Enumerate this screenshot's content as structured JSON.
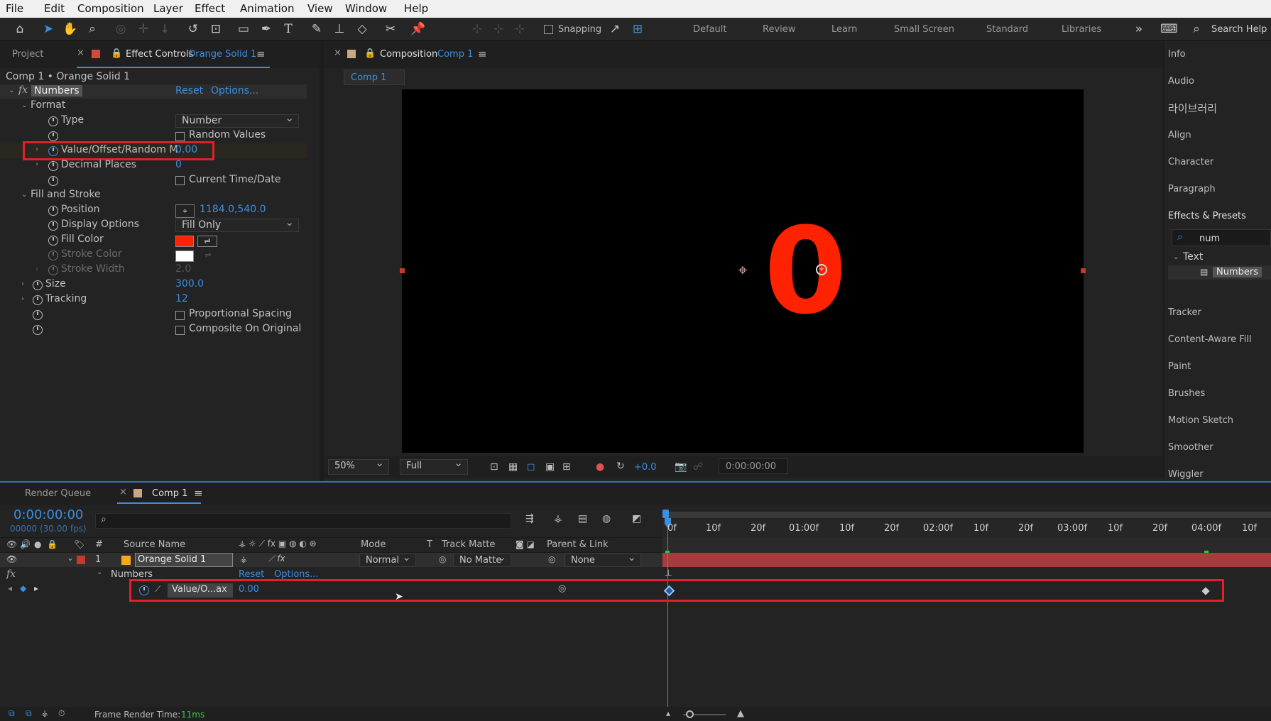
{
  "menu": [
    "File",
    "Edit",
    "Composition",
    "Layer",
    "Effect",
    "Animation",
    "View",
    "Window",
    "Help"
  ],
  "toolbar": {
    "snapping_label": "Snapping",
    "workspaces": [
      "Default",
      "Review",
      "Learn",
      "Small Screen",
      "Standard",
      "Libraries"
    ],
    "search_help": "Search Help"
  },
  "effect_controls": {
    "tab_project": "Project",
    "tab_label": "Effect Controls",
    "tab_layer": "Orange Solid 1",
    "breadcrumb": "Comp 1 • Orange Solid 1",
    "effect_name": "Numbers",
    "reset": "Reset",
    "options": "Options...",
    "format": "Format",
    "type_label": "Type",
    "type_value": "Number",
    "random_values": "Random Values",
    "value_label": "Value/Offset/Random M",
    "value_value": "0.00",
    "decimal_label": "Decimal Places",
    "decimal_value": "0",
    "current_time": "Current Time/Date",
    "fill_stroke": "Fill and Stroke",
    "position_label": "Position",
    "position_value": "1184.0,540.0",
    "display_label": "Display Options",
    "display_value": "Fill Only",
    "fill_color_label": "Fill Color",
    "fill_color": "#ff2200",
    "stroke_color_label": "Stroke Color",
    "stroke_width_label": "Stroke Width",
    "stroke_width_value": "2.0",
    "size_label": "Size",
    "size_value": "300.0",
    "tracking_label": "Tracking",
    "tracking_value": "12",
    "proportional": "Proportional Spacing",
    "composite": "Composite On Original"
  },
  "composition": {
    "tab_label": "Composition",
    "tab_comp": "Comp 1",
    "sub_tab": "Comp 1",
    "digit": "0",
    "zoom": "50%",
    "resolution": "Full",
    "exposure": "+0.0",
    "timecode": "0:00:00:00"
  },
  "right_panel": {
    "items_top": [
      "Info",
      "Audio",
      "라이브러리",
      "Align",
      "Character",
      "Paragraph",
      "Effects & Presets"
    ],
    "search": "num",
    "category": "Text",
    "effect": "Numbers",
    "items_bottom": [
      "Tracker",
      "Content-Aware Fill",
      "Paint",
      "Brushes",
      "Motion Sketch",
      "Smoother",
      "Wiggler"
    ]
  },
  "timeline": {
    "tab_render": "Render Queue",
    "tab_comp": "Comp 1",
    "timecode": "0:00:00:00",
    "fps": "00000 (30.00 fps)",
    "col_num": "#",
    "col_source": "Source Name",
    "col_mode": "Mode",
    "col_t": "T",
    "col_track": "Track Matte",
    "col_parent": "Parent & Link",
    "layer_num": "1",
    "layer_name": "Orange Solid 1",
    "layer_mode": "Normal",
    "layer_matte": "No Matte",
    "layer_parent": "None",
    "effect_row": "Numbers",
    "effect_reset": "Reset",
    "effect_options": "Options...",
    "prop_name": "Value/O...ax",
    "prop_value": "0.00",
    "ruler": [
      "0f",
      "10f",
      "20f",
      "01:00f",
      "10f",
      "20f",
      "02:00f",
      "10f",
      "20f",
      "03:00f",
      "10f",
      "20f",
      "04:00f",
      "10f"
    ],
    "frame_render_label": "Frame Render Time:",
    "frame_render_value": "11ms"
  }
}
